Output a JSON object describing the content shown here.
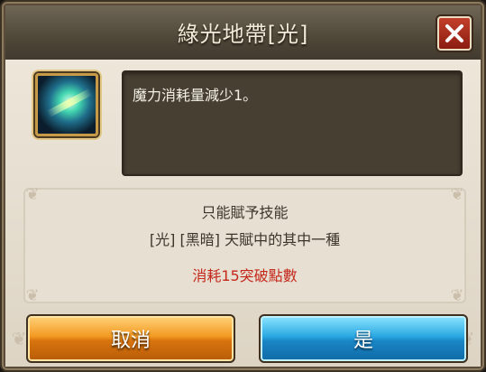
{
  "dialog": {
    "title": "綠光地帶[光]",
    "close_icon": "close-x-icon",
    "skill_icon": "green-light-skill-icon"
  },
  "description": {
    "text": "魔力消耗量減少1。"
  },
  "info": {
    "line1": "只能賦予技能",
    "line2": "[光] [黑暗] 天賦中的其中一種",
    "cost": "消耗15突破點數"
  },
  "buttons": {
    "cancel": "取消",
    "confirm": "是"
  },
  "colors": {
    "titlebar": "#4f4738",
    "cost_text": "#c4281c",
    "cancel_button": "#f39a22",
    "confirm_button": "#2aa8e2"
  }
}
